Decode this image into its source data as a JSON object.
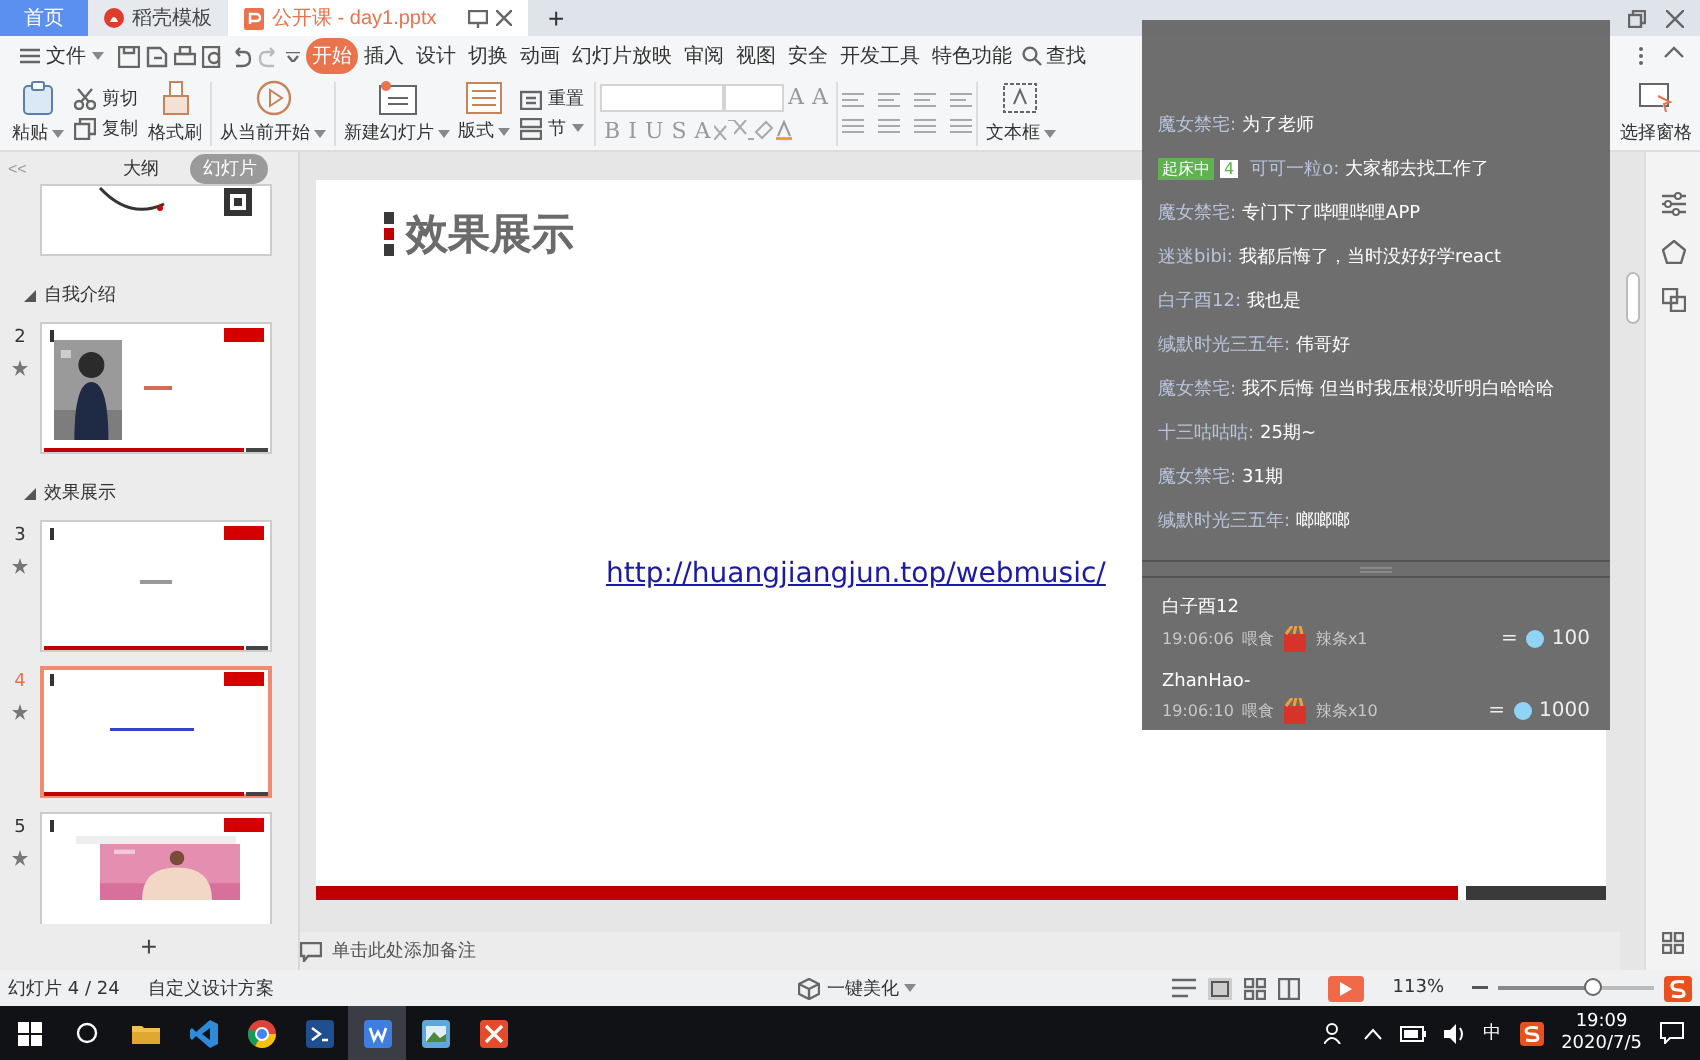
{
  "title_bar": {
    "tabs": [
      {
        "label": "首页",
        "kind": "home",
        "selected": false
      },
      {
        "label": "稻壳模板",
        "kind": "template",
        "selected": false
      },
      {
        "label": "公开课 - day1.pptx",
        "kind": "document",
        "selected": true
      }
    ],
    "new_tab": "+"
  },
  "menu": {
    "file": "文件",
    "tabs": [
      {
        "label": "开始",
        "selected": true
      },
      {
        "label": "插入",
        "selected": false
      },
      {
        "label": "设计",
        "selected": false
      },
      {
        "label": "切换",
        "selected": false
      },
      {
        "label": "动画",
        "selected": false
      },
      {
        "label": "幻灯片放映",
        "selected": false
      },
      {
        "label": "审阅",
        "selected": false
      },
      {
        "label": "视图",
        "selected": false
      },
      {
        "label": "安全",
        "selected": false
      },
      {
        "label": "开发工具",
        "selected": false
      },
      {
        "label": "特色功能",
        "selected": false
      }
    ],
    "search": "查找"
  },
  "ribbon": {
    "paste": "粘贴",
    "cut": "剪切",
    "copy": "复制",
    "format_painter": "格式刷",
    "play_from_current": "从当前开始",
    "new_slide": "新建幻灯片",
    "layout": "版式",
    "reset": "重置",
    "section": "节",
    "font_size_buttons": [
      "A",
      "A"
    ],
    "format_buttons": [
      "B",
      "I",
      "U",
      "S",
      "A"
    ],
    "text_box": "文本框",
    "selection_pane": "选择窗格"
  },
  "slides_panel": {
    "collapse": "<<",
    "views": [
      {
        "label": "大纲",
        "selected": false
      },
      {
        "label": "幻灯片",
        "selected": true
      }
    ],
    "items": [
      {
        "kind": "ending",
        "selected": false
      },
      {
        "kind": "section",
        "title": "自我介绍",
        "expanded": true
      },
      {
        "kind": "profile",
        "number": "2",
        "selected": false
      },
      {
        "kind": "section",
        "title": "效果展示",
        "expanded": true
      },
      {
        "kind": "heading",
        "number": "3",
        "selected": false
      },
      {
        "kind": "link",
        "number": "4",
        "selected": true
      },
      {
        "kind": "gallery",
        "number": "5",
        "selected": false
      }
    ],
    "add": "+"
  },
  "slide": {
    "title": "效果展示",
    "link": "http://huangjiangjun.top/webmusic/"
  },
  "notes": {
    "placeholder": "单击此处添加备注"
  },
  "status_bar": {
    "slide_count": "幻灯片 4 / 24",
    "theme": "自定义设计方案",
    "beautify": "一键美化",
    "zoom": "113%",
    "zoom_slider": {
      "level": 0.6
    }
  },
  "chat": {
    "messages": [
      {
        "user": "魔女禁宅:",
        "text": "为了老师"
      },
      {
        "badge": {
          "label": "起床中",
          "level": "4"
        },
        "user": "可可一粒o:",
        "text": "大家都去找工作了"
      },
      {
        "user": "魔女禁宅:",
        "text": "专门下了哔哩哔哩APP"
      },
      {
        "user": "迷迷bibi:",
        "text": "我都后悔了，当时没好好学react"
      },
      {
        "user": "白子酉12:",
        "text": "我也是"
      },
      {
        "user": "缄默时光三五年:",
        "text": "伟哥好"
      },
      {
        "user": "魔女禁宅:",
        "text": "我不后悔 但当时我压根没听明白哈哈哈"
      },
      {
        "user": "十三咕咕咕:",
        "text": "25期~"
      },
      {
        "user": "魔女禁宅:",
        "text": "31期"
      },
      {
        "user": "缄默时光三五年:",
        "text": "啷啷啷"
      }
    ],
    "gifts": [
      {
        "user": "白子酉12",
        "time": "19:06:06",
        "action": "喂食",
        "gift": "辣条x1",
        "sign": "=",
        "value": "100"
      },
      {
        "user": "ZhanHao-",
        "time": "19:06:10",
        "action": "喂食",
        "gift": "辣条x10",
        "sign": "=",
        "value": "1000"
      }
    ]
  },
  "taskbar": {
    "apps": [
      {
        "kind": "folder",
        "active": false
      },
      {
        "kind": "editor",
        "active": false
      },
      {
        "kind": "browser",
        "active": false
      },
      {
        "kind": "terminal",
        "active": false
      },
      {
        "kind": "writer",
        "active": true
      },
      {
        "kind": "viewer",
        "active": false
      },
      {
        "kind": "mindmap",
        "active": false
      }
    ],
    "ime": "中",
    "time": "19:09",
    "date": "2020/7/5"
  }
}
